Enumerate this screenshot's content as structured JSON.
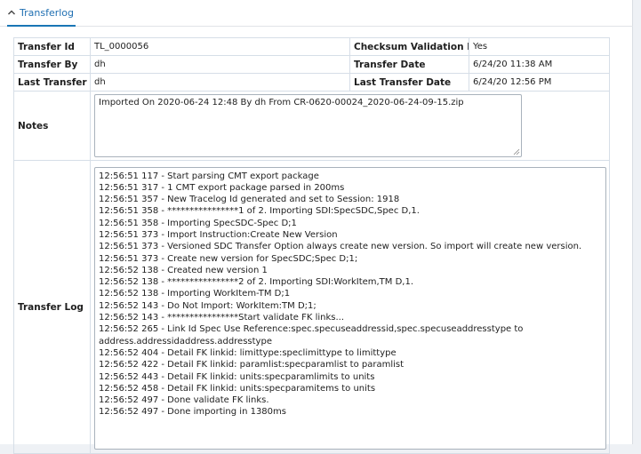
{
  "tab": {
    "label": "Transferlog",
    "icon": "chevron-up-icon"
  },
  "fields": {
    "transfer_id_label": "Transfer Id",
    "transfer_id_value": "TL_0000056",
    "checksum_label": "Checksum Validation Flag",
    "checksum_value": "Yes",
    "transfer_by_label": "Transfer By",
    "transfer_by_value": "dh",
    "transfer_date_label": "Transfer Date",
    "transfer_date_value": "6/24/20 11:38 AM",
    "last_transfer_by_label": "Last Transfer By",
    "last_transfer_by_value": "dh",
    "last_transfer_date_label": "Last Transfer Date",
    "last_transfer_date_value": "6/24/20 12:56 PM",
    "notes_label": "Notes",
    "notes_value": "Imported On 2020-06-24 12:48 By dh From CR-0620-00024_2020-06-24-09-15.zip",
    "transfer_log_label": "Transfer Log"
  },
  "log_lines": [
    "12:56:51 117 - Start parsing CMT export package",
    "12:56:51 317 - 1 CMT export package parsed in 200ms",
    "12:56:51 357 - New Tracelog Id generated and set to Session: 1918",
    "12:56:51 358 - ****************1 of 2. Importing SDI:SpecSDC,Spec D,1.",
    "12:56:51 358 - Importing SpecSDC-Spec D;1",
    "12:56:51 373 - Import Instruction:Create New Version",
    "12:56:51 373 - Versioned SDC Transfer Option always create new version. So import will create new version.",
    "12:56:51 373 - Create new version for SpecSDC;Spec D;1;",
    "12:56:52 138 - Created new version 1",
    "12:56:52 138 - ****************2 of 2. Importing SDI:WorkItem,TM D,1.",
    "12:56:52 138 - Importing WorkItem-TM D;1",
    "12:56:52 143 - Do Not Import: WorkItem:TM D;1;",
    "12:56:52 143 - ****************Start validate FK links...",
    "12:56:52 265 - Link Id Spec Use Reference:spec.specuseaddressid,spec.specuseaddresstype to address.addressidaddress.addresstype",
    "12:56:52 404 - Detail FK linkid: limittype:speclimittype to limittype",
    "12:56:52 422 - Detail FK linkid: paramlist:specparamlist to paramlist",
    "12:56:52 443 - Detail FK linkid: units:specparamlimits to units",
    "12:56:52 458 - Detail FK linkid: units:specparamitems to units",
    "12:56:52 497 - Done validate FK links.",
    "12:56:52 497 - Done importing in 1380ms"
  ]
}
